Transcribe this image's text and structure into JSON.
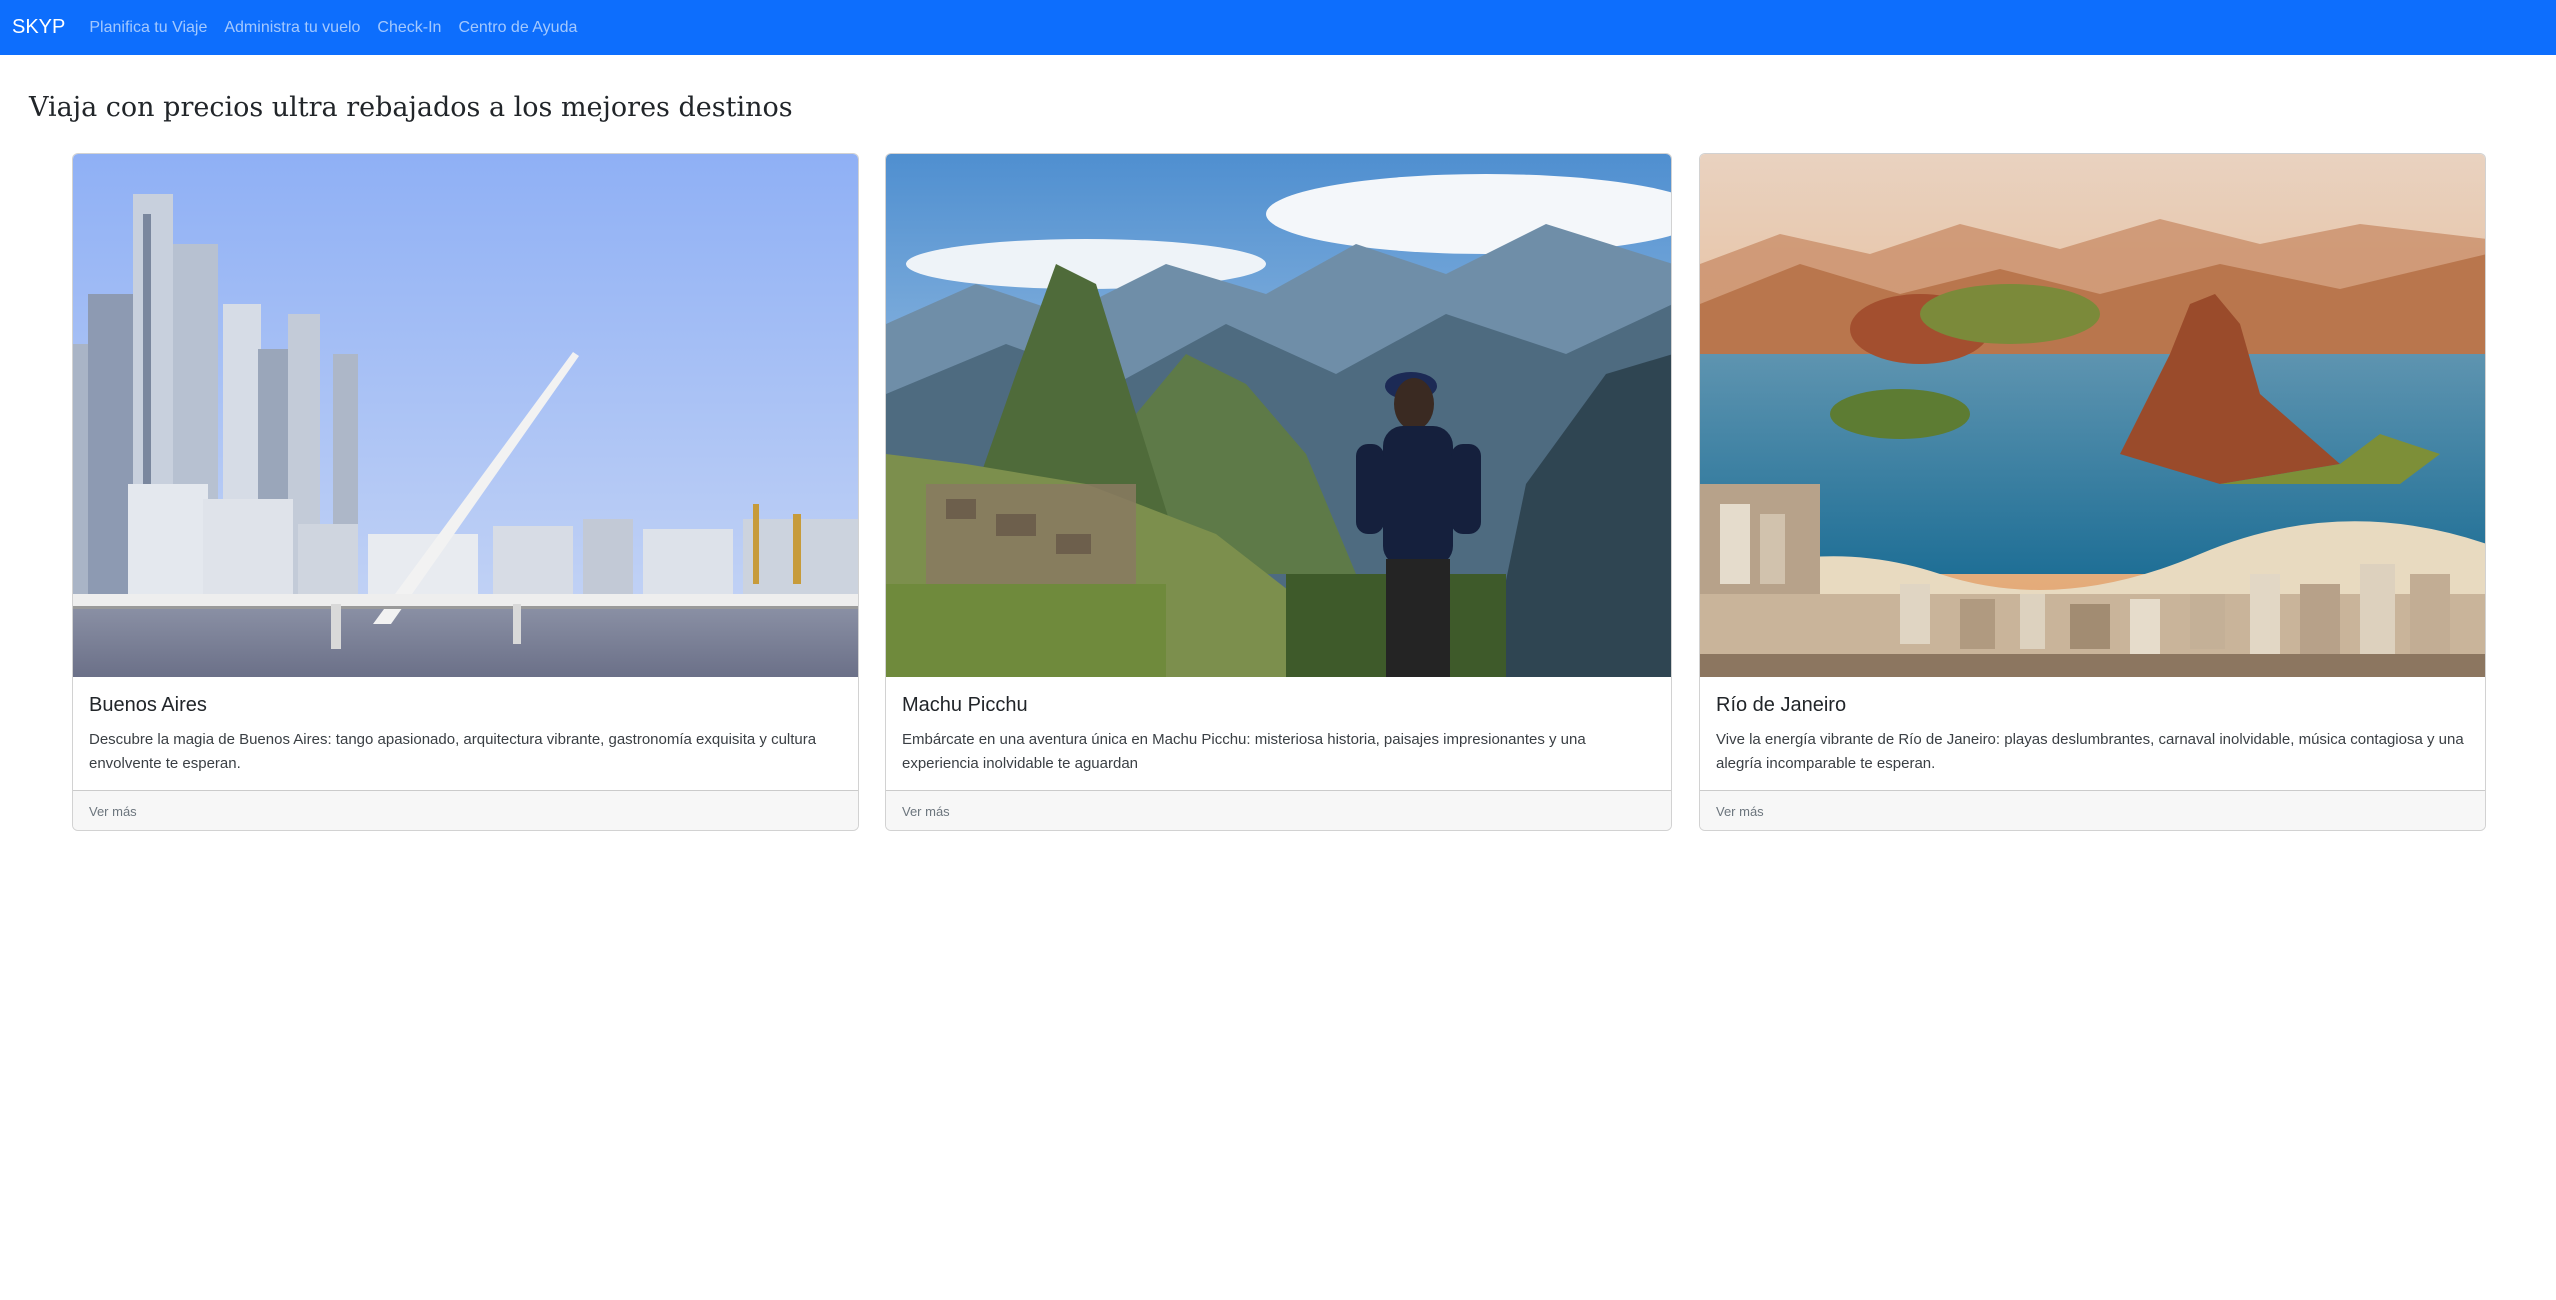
{
  "navbar": {
    "brand": "SKYP",
    "links": [
      "Planifica tu Viaje",
      "Administra tu vuelo",
      "Check-In",
      "Centro de Ayuda"
    ],
    "background_color": "#0d6efd"
  },
  "main": {
    "headline": "Viaja con precios ultra rebajados a los mejores destinos",
    "cards": [
      {
        "title": "Buenos Aires",
        "text": "Descubre la magia de Buenos Aires: tango apasionado, arquitectura vibrante, gastronomía exquisita y cultura envolvente te esperan.",
        "link": "Ver más"
      },
      {
        "title": "Machu Picchu",
        "text": "Embárcate en una aventura única en Machu Picchu: misteriosa historia, paisajes impresionantes y una experiencia inolvidable te aguardan",
        "link": "Ver más"
      },
      {
        "title": "Río de Janeiro",
        "text": "Vive la energía vibrante de Río de Janeiro: playas deslumbrantes, carnaval inolvidable, música contagiosa y una alegría incomparable te esperan.",
        "link": "Ver más"
      }
    ]
  }
}
